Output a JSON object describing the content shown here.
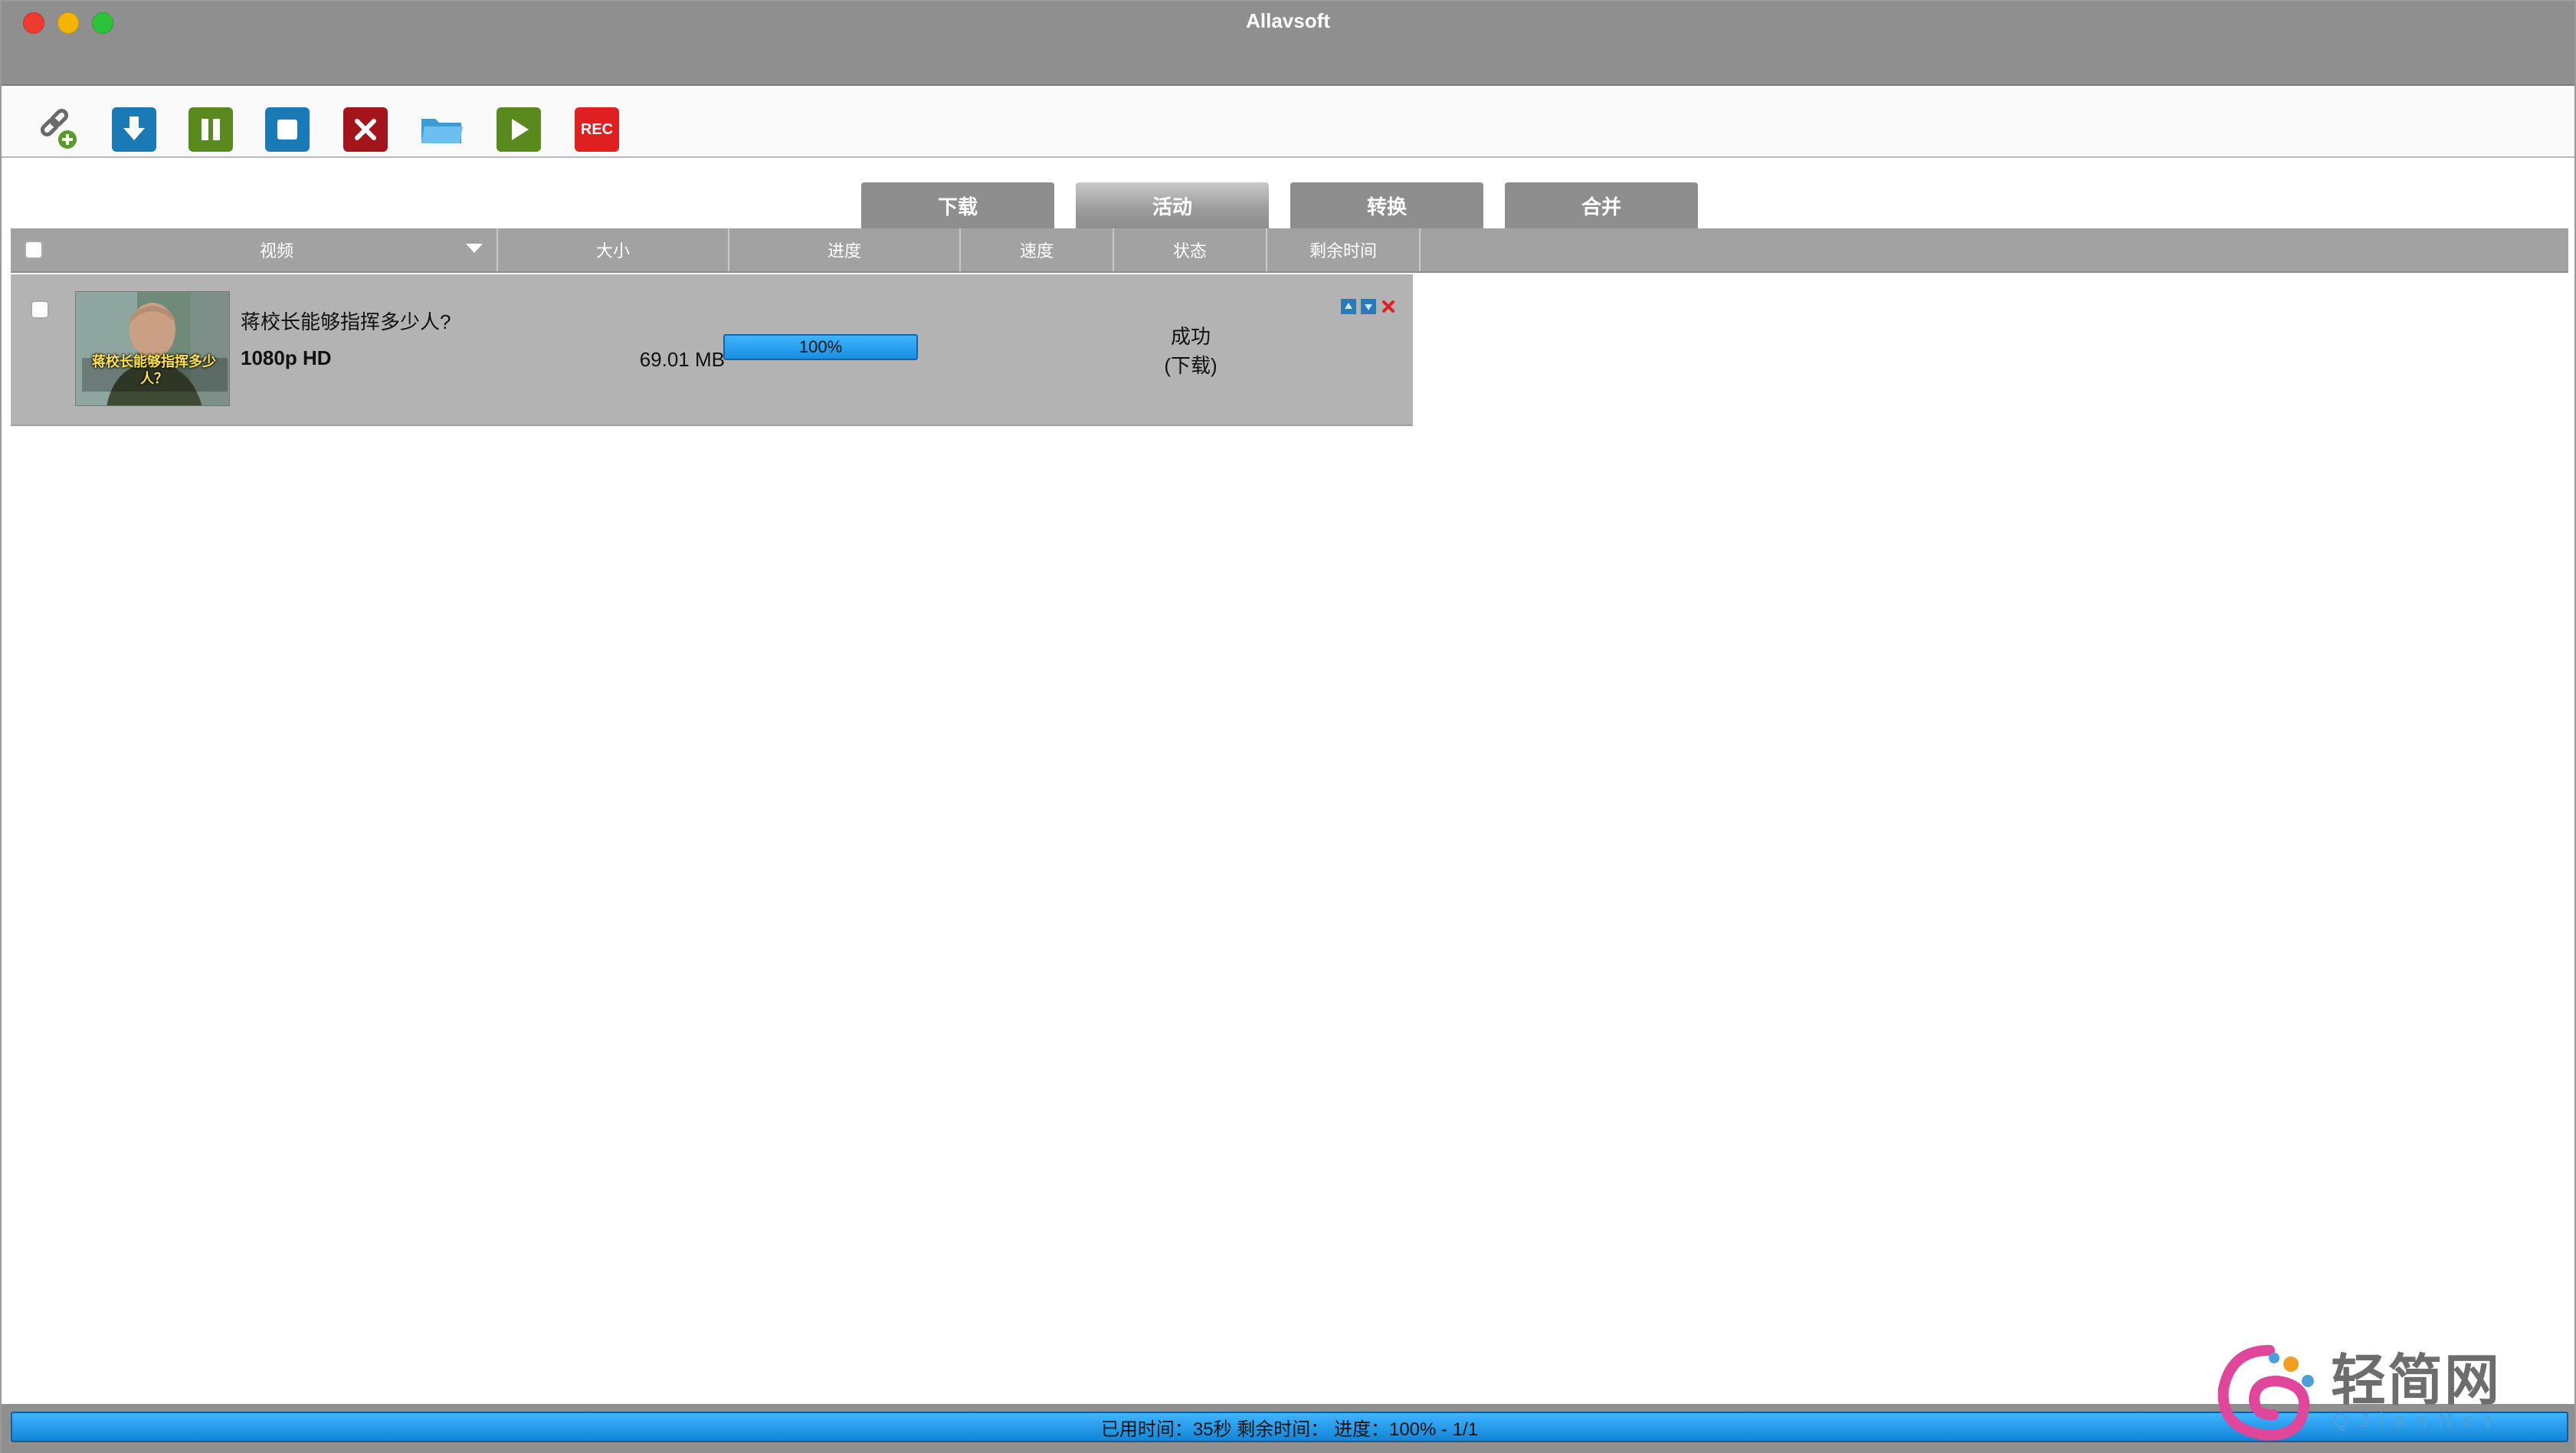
{
  "app": {
    "title": "Allavsoft"
  },
  "toolbar": {
    "buttons": [
      {
        "name": "paste-link",
        "icon": "link-add-icon"
      },
      {
        "name": "download",
        "icon": "download-icon"
      },
      {
        "name": "pause",
        "icon": "pause-icon"
      },
      {
        "name": "stop",
        "icon": "stop-icon"
      },
      {
        "name": "delete",
        "icon": "delete-icon"
      },
      {
        "name": "open-folder",
        "icon": "folder-icon"
      },
      {
        "name": "play",
        "icon": "play-icon"
      },
      {
        "name": "record",
        "icon": "rec-icon",
        "label": "REC"
      }
    ]
  },
  "tabs": [
    {
      "label": "下载",
      "active": false
    },
    {
      "label": "活动",
      "active": true
    },
    {
      "label": "转换",
      "active": false
    },
    {
      "label": "合并",
      "active": false
    }
  ],
  "table": {
    "columns": {
      "video": "视频",
      "size": "大小",
      "progress": "进度",
      "speed": "速度",
      "status": "状态",
      "remaining": "剩余时间"
    },
    "rows": [
      {
        "title": "蒋校长能够指挥多少人?",
        "quality": "1080p HD",
        "thumbnail_caption": "蒋校长能够指挥多少人？",
        "size": "69.01 MB",
        "progress_text": "100%",
        "progress_fraction": 1.0,
        "speed": "",
        "status_line1": "成功",
        "status_line2": "(下载)",
        "remaining": ""
      }
    ]
  },
  "statusbar": {
    "text": "已用时间：35秒  剩余时间：  进度：100% - 1/1",
    "progress_fraction": 1.0
  },
  "watermark": {
    "text": "轻简网",
    "sub": "QJianNet"
  },
  "colors": {
    "accent_blue": "#1a7ab5",
    "green": "#5a8a1d",
    "red": "#a4141b",
    "rec_red": "#e02020",
    "progress_blue": "#2aa0f0"
  }
}
